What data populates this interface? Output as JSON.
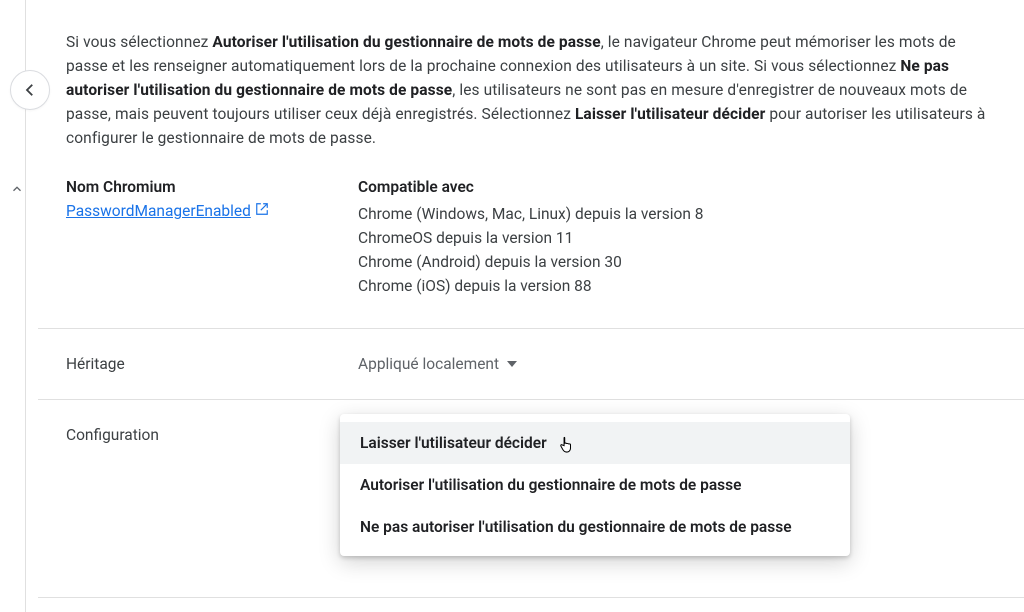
{
  "description": {
    "p1_a": "Si vous sélectionnez ",
    "p1_b1": "Autoriser l'utilisation du gestionnaire de mots de passe",
    "p1_c": ", le navigateur Chrome peut mémoriser les mots de passe et les renseigner automatiquement lors de la prochaine connexion des utilisateurs à un site. Si vous sélectionnez ",
    "p1_b2": "Ne pas autoriser l'utilisation du gestionnaire de mots de passe",
    "p1_d": ", les utilisateurs ne sont pas en mesure d'enregistrer de nouveaux mots de passe, mais peuvent toujours utiliser ceux déjà enregistrés. Sélectionnez ",
    "p1_b3": "Laisser l'utilisateur décider",
    "p1_e": " pour autoriser les utilisateurs à configurer le gestionnaire de mots de passe."
  },
  "meta": {
    "chromium_label": "Nom Chromium",
    "chromium_name": "PasswordManagerEnabled",
    "compat_label": "Compatible avec",
    "compat_lines": [
      "Chrome (Windows, Mac, Linux) depuis la version 8",
      "ChromeOS depuis la version 11",
      "Chrome (Android) depuis la version 30",
      "Chrome (iOS) depuis la version 88"
    ]
  },
  "inheritance": {
    "label": "Héritage",
    "value": "Appliqué localement"
  },
  "configuration": {
    "label": "Configuration",
    "options": [
      "Laisser l'utilisateur décider",
      "Autoriser l'utilisation du gestionnaire de mots de passe",
      "Ne pas autoriser l'utilisation du gestionnaire de mots de passe"
    ]
  }
}
